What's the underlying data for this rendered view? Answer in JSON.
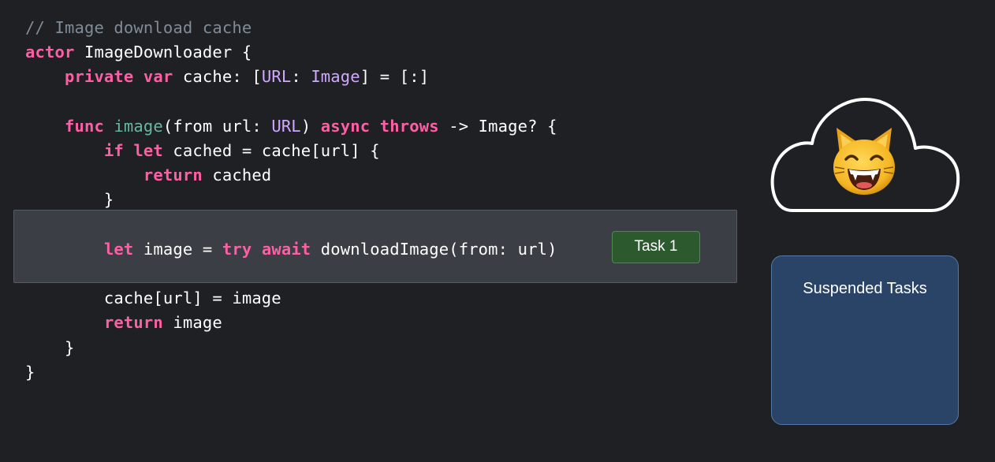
{
  "code": {
    "lines": [
      [
        {
          "t": "comment",
          "s": "// Image download cache"
        }
      ],
      [
        {
          "t": "keyword",
          "s": "actor"
        },
        {
          "t": "plain",
          "s": " ImageDownloader {"
        }
      ],
      [
        {
          "t": "plain",
          "s": "    "
        },
        {
          "t": "keyword",
          "s": "private"
        },
        {
          "t": "plain",
          "s": " "
        },
        {
          "t": "keyword",
          "s": "var"
        },
        {
          "t": "plain",
          "s": " cache: ["
        },
        {
          "t": "type",
          "s": "URL"
        },
        {
          "t": "plain",
          "s": ": "
        },
        {
          "t": "type",
          "s": "Image"
        },
        {
          "t": "plain",
          "s": "] = [:]"
        }
      ],
      [],
      [
        {
          "t": "plain",
          "s": "    "
        },
        {
          "t": "keyword",
          "s": "func"
        },
        {
          "t": "plain",
          "s": " "
        },
        {
          "t": "func",
          "s": "image"
        },
        {
          "t": "plain",
          "s": "(from url: "
        },
        {
          "t": "type",
          "s": "URL"
        },
        {
          "t": "plain",
          "s": ") "
        },
        {
          "t": "keyword",
          "s": "async"
        },
        {
          "t": "plain",
          "s": " "
        },
        {
          "t": "keyword",
          "s": "throws"
        },
        {
          "t": "plain",
          "s": " -> Image? {"
        }
      ],
      [
        {
          "t": "plain",
          "s": "        "
        },
        {
          "t": "keyword",
          "s": "if"
        },
        {
          "t": "plain",
          "s": " "
        },
        {
          "t": "keyword",
          "s": "let"
        },
        {
          "t": "plain",
          "s": " cached = cache[url] {"
        }
      ],
      [
        {
          "t": "plain",
          "s": "            "
        },
        {
          "t": "keyword",
          "s": "return"
        },
        {
          "t": "plain",
          "s": " cached"
        }
      ],
      [
        {
          "t": "plain",
          "s": "        }"
        }
      ],
      [],
      [
        {
          "t": "plain",
          "s": "        "
        },
        {
          "t": "keyword",
          "s": "let"
        },
        {
          "t": "plain",
          "s": " image = "
        },
        {
          "t": "keyword",
          "s": "try"
        },
        {
          "t": "plain",
          "s": " "
        },
        {
          "t": "keyword",
          "s": "await"
        },
        {
          "t": "plain",
          "s": " downloadImage(from: url)"
        }
      ],
      [],
      [
        {
          "t": "plain",
          "s": "        cache[url] = image"
        }
      ],
      [
        {
          "t": "plain",
          "s": "        "
        },
        {
          "t": "keyword",
          "s": "return"
        },
        {
          "t": "plain",
          "s": " image"
        }
      ],
      [
        {
          "t": "plain",
          "s": "    }"
        }
      ],
      [
        {
          "t": "plain",
          "s": "}"
        }
      ]
    ]
  },
  "task_badge": {
    "label": "Task 1"
  },
  "cloud": {
    "icon": "cloud-icon",
    "emoji_icon": "grinning-cat-emoji-icon"
  },
  "suspended_panel": {
    "title": "Suspended Tasks"
  },
  "colors": {
    "background": "#1f2024",
    "keyword": "#fc5fa3",
    "type": "#d0a8ff",
    "function": "#67b7a4",
    "comment": "#7f8c98",
    "task_badge": "#2c5a2e",
    "suspended_panel": "#2a4468"
  }
}
